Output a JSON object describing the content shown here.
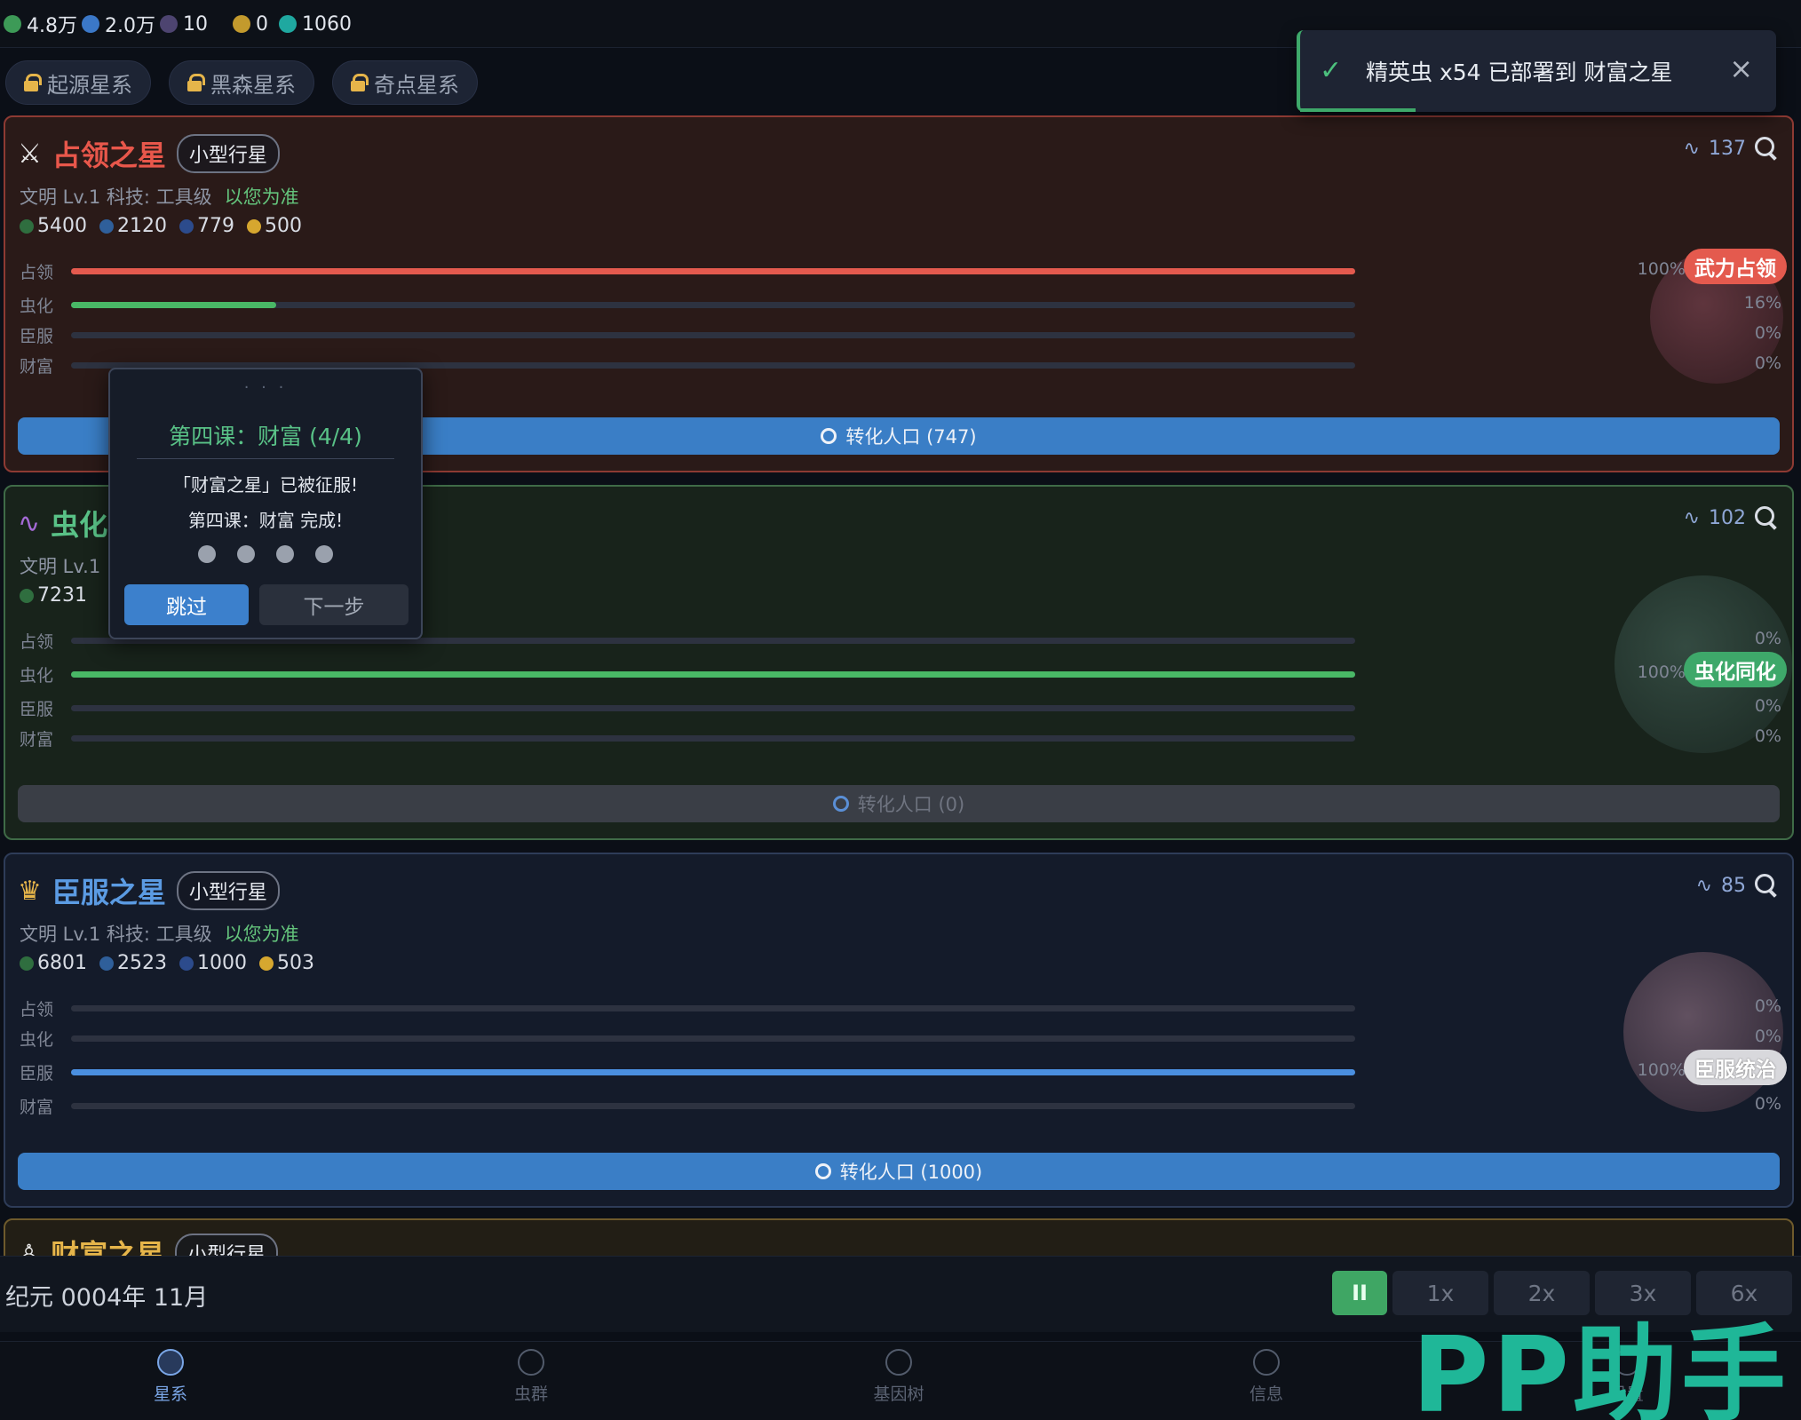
{
  "resources": [
    {
      "value": "4.8万",
      "icon": "green-resource-icon",
      "color": "#3d9a57"
    },
    {
      "value": "2.0万",
      "icon": "blue-gem-icon",
      "color": "#3b78c8"
    },
    {
      "value": "10",
      "icon": "purple-resource-icon",
      "color": "#4d4470"
    },
    {
      "value": "0",
      "icon": "gold-resource-icon",
      "color": "#c39a2d"
    },
    {
      "value": "1060",
      "icon": "teal-ring-icon",
      "color": "#1fa8a0"
    }
  ],
  "galaxy_tabs": [
    "起源星系",
    "黑森星系",
    "奇点星系"
  ],
  "toast": {
    "message": "精英虫 x54 已部署到 财富之星",
    "close": "×"
  },
  "cards": [
    {
      "name": "占领之星",
      "size_badge": "小型行星",
      "subline": "文明 Lv.1   科技: 工具级",
      "subline_status": "以您为准",
      "stats": [
        "5400",
        "2120",
        "779",
        "500"
      ],
      "bug_count": "137",
      "bars": [
        {
          "label": "占领",
          "percent": 100,
          "text": "100%",
          "pill": "武力占领"
        },
        {
          "label": "虫化",
          "percent": 16,
          "text": "16%"
        },
        {
          "label": "臣服",
          "percent": 0,
          "text": "0%"
        },
        {
          "label": "财富",
          "percent": 0,
          "text": "0%"
        }
      ],
      "action": "转化人口 (747)"
    },
    {
      "name": "虫化",
      "subline": "文明 Lv.1",
      "stats": [
        "7231"
      ],
      "bug_count": "102",
      "bars": [
        {
          "label": "占领",
          "percent": 0,
          "text": "0%"
        },
        {
          "label": "虫化",
          "percent": 100,
          "text": "100%",
          "pill": "虫化同化"
        },
        {
          "label": "臣服",
          "percent": 0,
          "text": "0%"
        },
        {
          "label": "财富",
          "percent": 0,
          "text": "0%"
        }
      ],
      "action": "转化人口 (0)"
    },
    {
      "name": "臣服之星",
      "size_badge": "小型行星",
      "subline": "文明 Lv.1   科技: 工具级",
      "subline_status": "以您为准",
      "stats": [
        "6801",
        "2523",
        "1000",
        "503"
      ],
      "bug_count": "85",
      "bars": [
        {
          "label": "占领",
          "percent": 0,
          "text": "0%"
        },
        {
          "label": "虫化",
          "percent": 0,
          "text": "0%"
        },
        {
          "label": "臣服",
          "percent": 100,
          "text": "100%",
          "pill": "臣服统治"
        },
        {
          "label": "财富",
          "percent": 0,
          "text": "0%"
        }
      ],
      "action": "转化人口 (1000)"
    },
    {
      "name": "财富之星",
      "size_badge": "小型行星"
    }
  ],
  "tutorial": {
    "handle": "· · ·",
    "title": "第四课：财富 (4/4)",
    "line1": "「财富之星」已被征服!",
    "line2": "第四课：财富 完成!",
    "skip": "跳过",
    "next": "下一步"
  },
  "time": {
    "date": "纪元 0004年 11月",
    "pause": "II",
    "speeds": [
      "1x",
      "2x",
      "3x",
      "6x"
    ]
  },
  "nav": [
    "星系",
    "虫群",
    "基因树",
    "信息",
    "设置"
  ],
  "watermark": "PP助手"
}
